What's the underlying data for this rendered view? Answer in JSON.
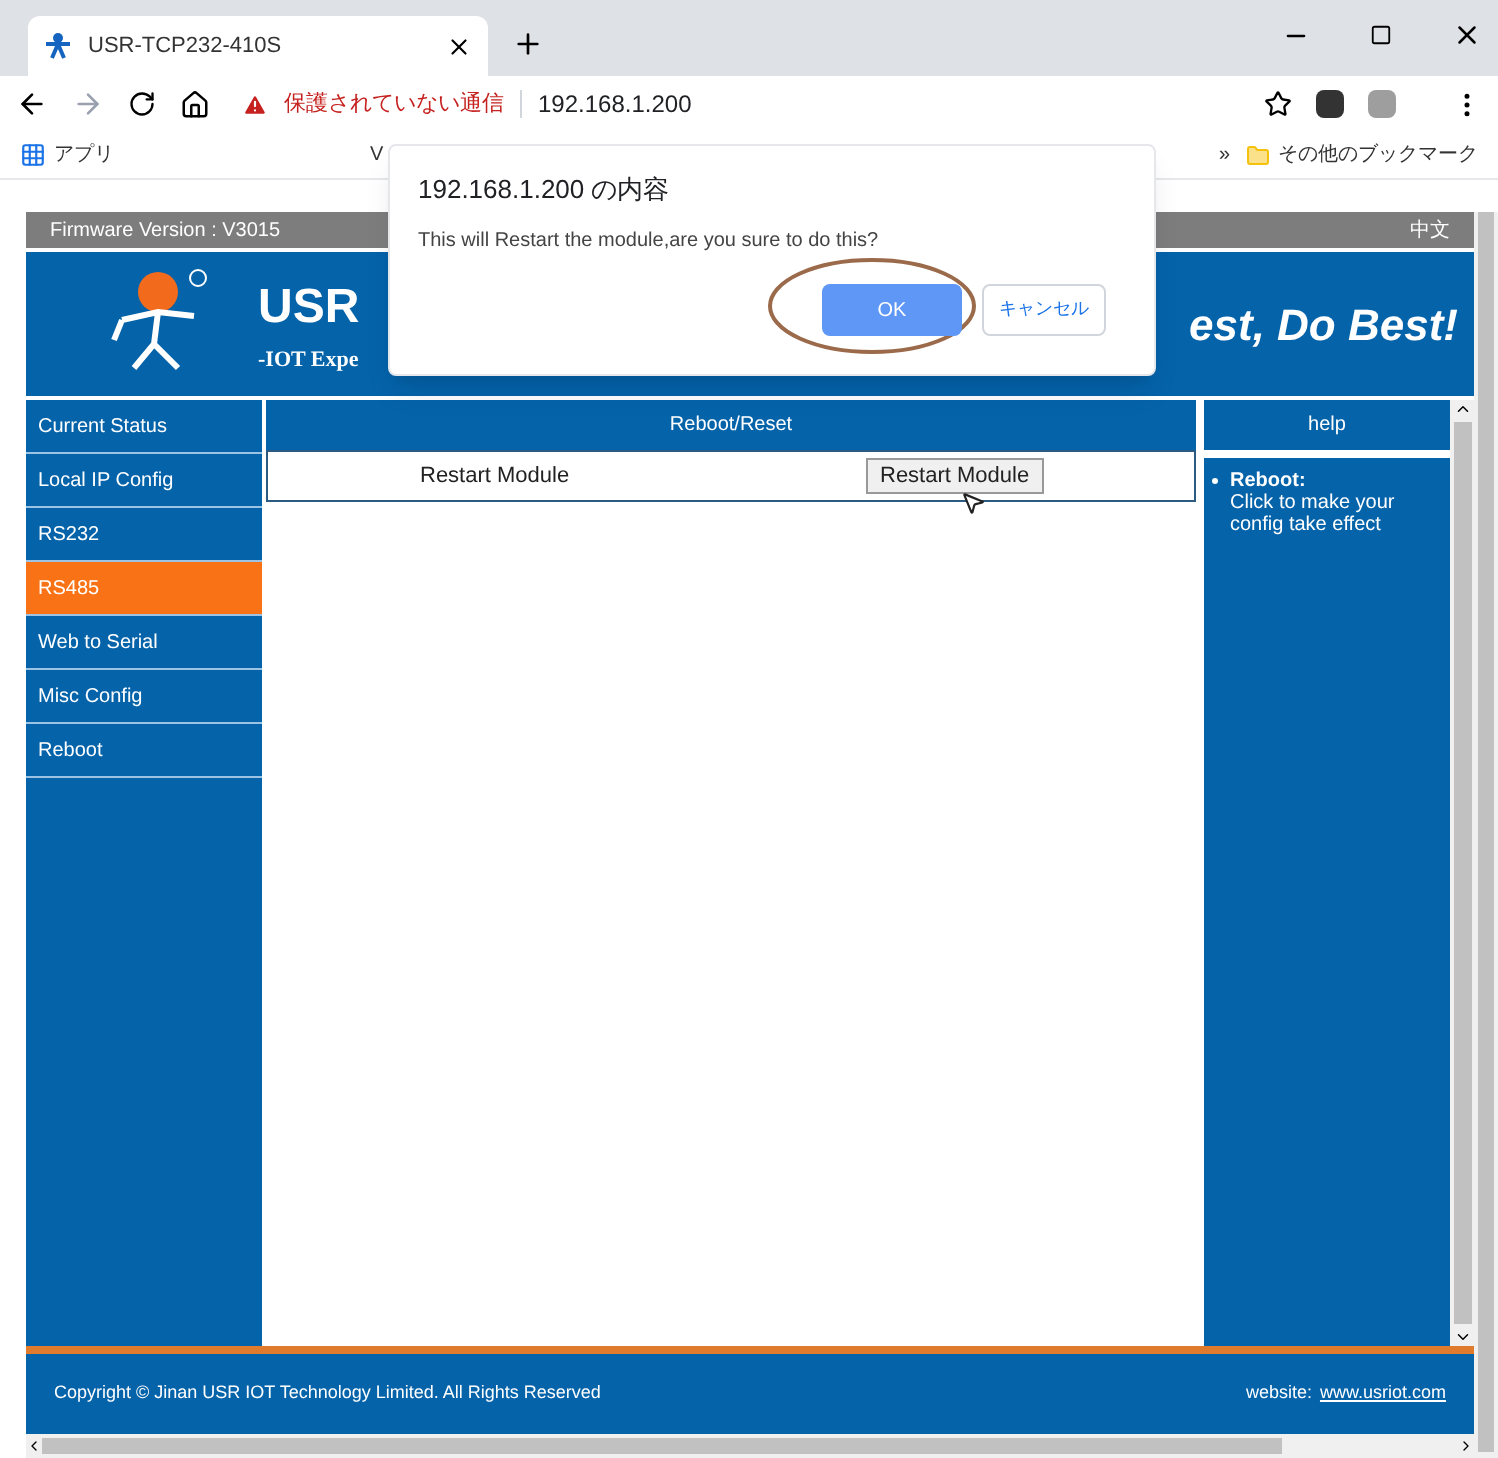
{
  "browser": {
    "tab_title": "USR-TCP232-410S",
    "security_warning": "保護されていない通信",
    "url": "192.168.1.200",
    "bookmarks": [
      {
        "label": "アプリ"
      },
      {
        "label": "V"
      }
    ],
    "other_bookmarks": "その他のブックマーク",
    "overflow": "»"
  },
  "topbar": {
    "firmware": "Firmware Version : V3015",
    "language": "中文"
  },
  "header": {
    "brand": "USR",
    "tagline": "-IOT Expe",
    "slogan": "est, Do Best!"
  },
  "sidebar": {
    "items": [
      {
        "label": "Current Status",
        "selected": false
      },
      {
        "label": "Local IP Config",
        "selected": false
      },
      {
        "label": "RS232",
        "selected": false
      },
      {
        "label": "RS485",
        "selected": true
      },
      {
        "label": "Web to Serial",
        "selected": false
      },
      {
        "label": "Misc Config",
        "selected": false
      },
      {
        "label": "Reboot",
        "selected": false
      }
    ]
  },
  "main": {
    "title": "Reboot/Reset",
    "rows": [
      {
        "label": "Restart Module",
        "button": "Restart Module"
      }
    ]
  },
  "help": {
    "title": "help",
    "items": [
      {
        "heading": "Reboot:",
        "text": "Click to make your config take effect"
      }
    ]
  },
  "footer": {
    "copyright": "Copyright © Jinan USR IOT Technology Limited. All Rights Reserved",
    "website_label": "website:",
    "website_link": "www.usriot.com"
  },
  "dialog": {
    "title": "192.168.1.200 の内容",
    "message": "This will Restart the module,are you sure to do this?",
    "ok": "OK",
    "cancel": "キャンセル"
  }
}
